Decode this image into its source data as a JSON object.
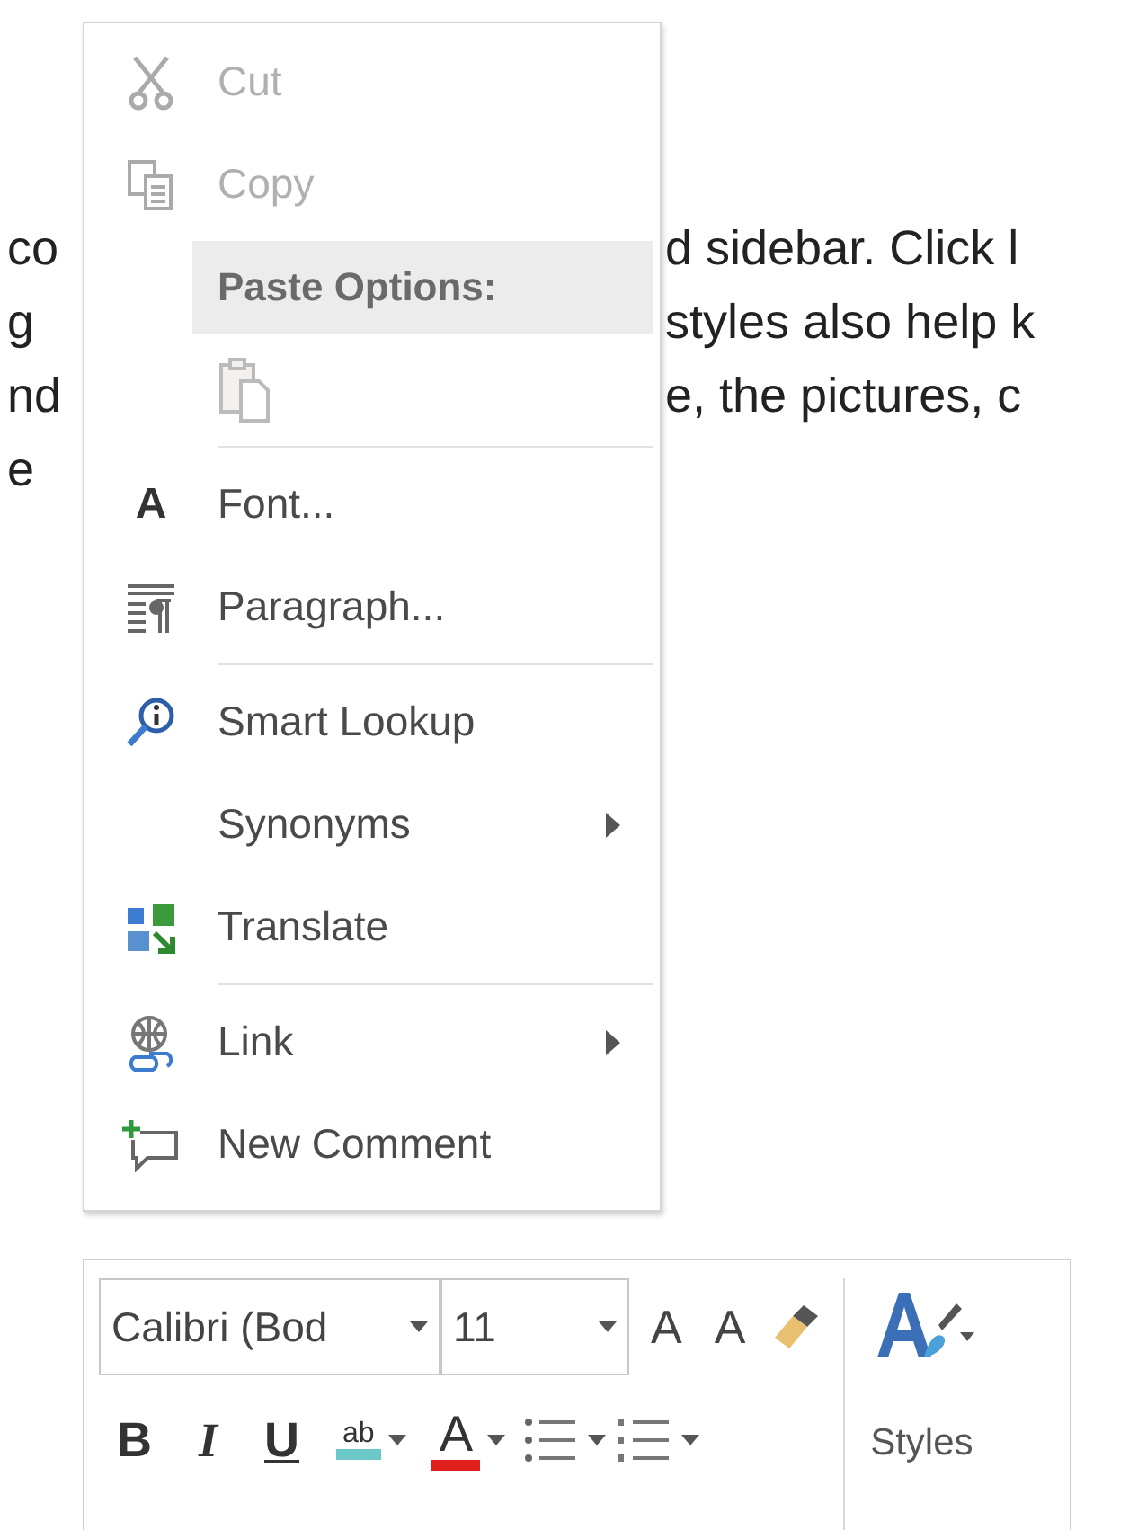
{
  "document": {
    "lines": [
      {
        "left": "co",
        "right": "d sidebar. Click l"
      },
      {
        "left": "g",
        "right": "styles also help k"
      },
      {
        "left": "nd",
        "right": "e, the pictures, c"
      },
      {
        "left": "e"
      }
    ]
  },
  "context_menu": {
    "items": [
      {
        "kind": "item",
        "label": "Cut",
        "disabled": true,
        "submenu": false
      },
      {
        "kind": "item",
        "label": "Copy",
        "disabled": true,
        "submenu": false
      },
      {
        "kind": "header",
        "label": "Paste Options:"
      },
      {
        "kind": "paste-icons",
        "disabled": true
      },
      {
        "kind": "separator"
      },
      {
        "kind": "item",
        "label": "Font...",
        "glyph": "A",
        "disabled": false,
        "submenu": false
      },
      {
        "kind": "item",
        "label": "Paragraph...",
        "disabled": false,
        "submenu": false
      },
      {
        "kind": "separator"
      },
      {
        "kind": "item",
        "label": "Smart Lookup",
        "disabled": false,
        "submenu": false
      },
      {
        "kind": "item",
        "label": "Synonyms",
        "disabled": false,
        "submenu": true
      },
      {
        "kind": "item",
        "label": "Translate",
        "disabled": false,
        "submenu": false
      },
      {
        "kind": "separator"
      },
      {
        "kind": "item",
        "label": "Link",
        "disabled": false,
        "submenu": true
      },
      {
        "kind": "item",
        "label": "New Comment",
        "disabled": false,
        "submenu": false
      }
    ]
  },
  "mini_toolbar": {
    "font_name": "Calibri (Bod",
    "font_size": "11",
    "size_buttons": [
      "A",
      "A"
    ],
    "format_buttons": [
      {
        "label": "B",
        "kind": "bold"
      },
      {
        "label": "I",
        "kind": "italic"
      },
      {
        "label": "U",
        "kind": "underline"
      }
    ],
    "highlight_label": "ab",
    "font_color_label": "A",
    "styles_label": "Styles"
  }
}
